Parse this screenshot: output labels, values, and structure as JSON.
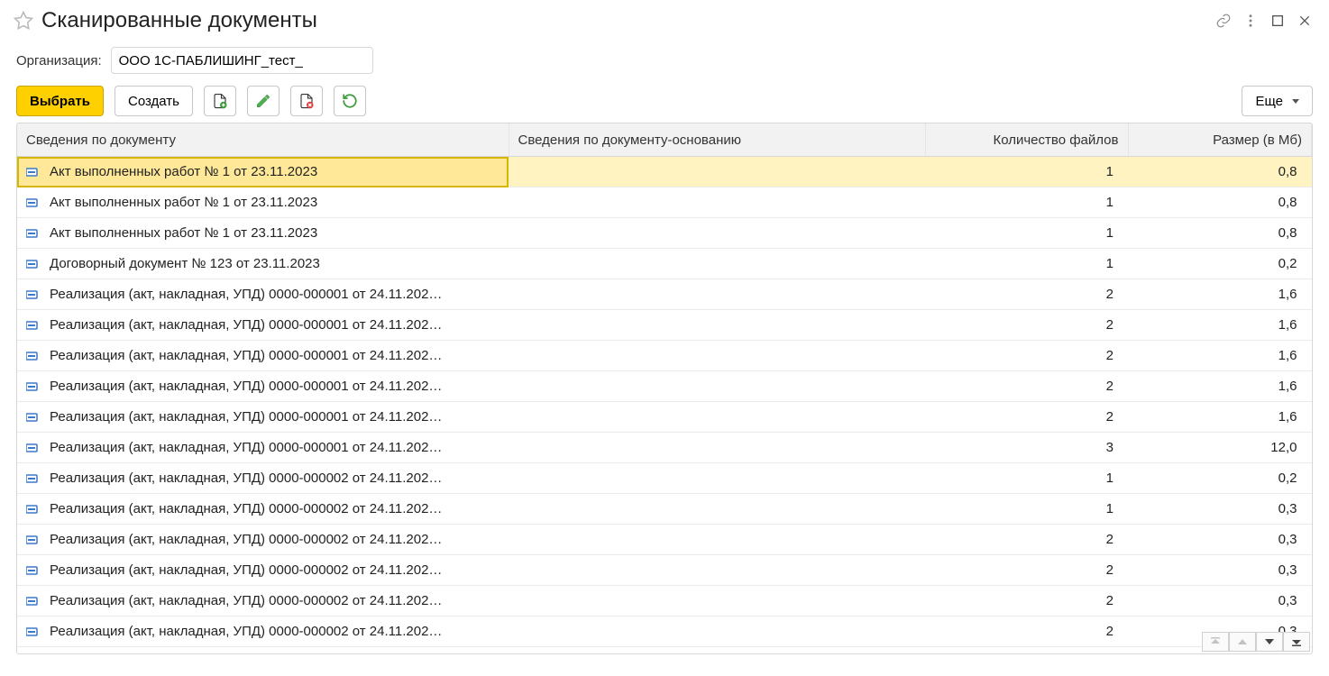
{
  "titlebar": {
    "title": "Сканированные документы"
  },
  "filter": {
    "label": "Организация:",
    "value": "ООО 1С-ПАБЛИШИНГ_тест_"
  },
  "toolbar": {
    "select": "Выбрать",
    "create": "Создать",
    "more": "Еще"
  },
  "columns": {
    "doc": "Сведения по документу",
    "base": "Сведения по документу-основанию",
    "files": "Количество файлов",
    "size": "Размер (в Мб)"
  },
  "rows": [
    {
      "doc": "Акт выполненных работ № 1 от 23.11.2023",
      "base": "",
      "files": "1",
      "size": "0,8",
      "selected": true
    },
    {
      "doc": "Акт выполненных работ № 1 от 23.11.2023",
      "base": "",
      "files": "1",
      "size": "0,8"
    },
    {
      "doc": "Акт выполненных работ № 1 от 23.11.2023",
      "base": "",
      "files": "1",
      "size": "0,8"
    },
    {
      "doc": "Договорный документ № 123 от 23.11.2023",
      "base": "",
      "files": "1",
      "size": "0,2"
    },
    {
      "doc": "Реализация (акт, накладная, УПД) 0000-000001 от 24.11.202…",
      "base": "",
      "files": "2",
      "size": "1,6"
    },
    {
      "doc": "Реализация (акт, накладная, УПД) 0000-000001 от 24.11.202…",
      "base": "",
      "files": "2",
      "size": "1,6"
    },
    {
      "doc": "Реализация (акт, накладная, УПД) 0000-000001 от 24.11.202…",
      "base": "",
      "files": "2",
      "size": "1,6"
    },
    {
      "doc": "Реализация (акт, накладная, УПД) 0000-000001 от 24.11.202…",
      "base": "",
      "files": "2",
      "size": "1,6"
    },
    {
      "doc": "Реализация (акт, накладная, УПД) 0000-000001 от 24.11.202…",
      "base": "",
      "files": "2",
      "size": "1,6"
    },
    {
      "doc": "Реализация (акт, накладная, УПД) 0000-000001 от 24.11.202…",
      "base": "",
      "files": "3",
      "size": "12,0"
    },
    {
      "doc": "Реализация (акт, накладная, УПД) 0000-000002 от 24.11.202…",
      "base": "",
      "files": "1",
      "size": "0,2"
    },
    {
      "doc": "Реализация (акт, накладная, УПД) 0000-000002 от 24.11.202…",
      "base": "",
      "files": "1",
      "size": "0,3"
    },
    {
      "doc": "Реализация (акт, накладная, УПД) 0000-000002 от 24.11.202…",
      "base": "",
      "files": "2",
      "size": "0,3"
    },
    {
      "doc": "Реализация (акт, накладная, УПД) 0000-000002 от 24.11.202…",
      "base": "",
      "files": "2",
      "size": "0,3"
    },
    {
      "doc": "Реализация (акт, накладная, УПД) 0000-000002 от 24.11.202…",
      "base": "",
      "files": "2",
      "size": "0,3"
    },
    {
      "doc": "Реализация (акт, накладная, УПД) 0000-000002 от 24.11.202…",
      "base": "",
      "files": "2",
      "size": "0,3"
    }
  ]
}
